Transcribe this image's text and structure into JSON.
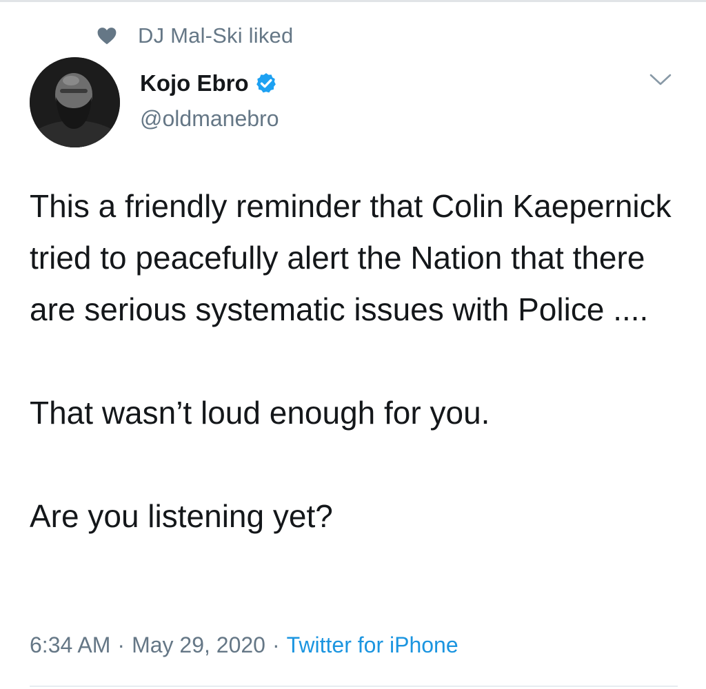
{
  "context": {
    "icon": "heart-icon",
    "text": "DJ Mal-Ski liked"
  },
  "author": {
    "display_name": "Kojo Ebro",
    "verified": true,
    "handle": "@oldmanebro",
    "avatar_icon": "avatar-photo"
  },
  "tweet": {
    "paragraphs": [
      "This a friendly reminder that Colin Kaepernick tried to peacefully alert the Nation that there are serious systematic issues with Police ....",
      "That wasn’t loud enough for you.",
      "Are you listening yet?"
    ]
  },
  "meta": {
    "time": "6:34 AM",
    "separator": "·",
    "date": "May 29, 2020",
    "source": "Twitter for iPhone"
  },
  "colors": {
    "text_primary": "#14171a",
    "text_secondary": "#657786",
    "accent_blue": "#1b95e0",
    "verified_blue": "#1da1f2"
  }
}
